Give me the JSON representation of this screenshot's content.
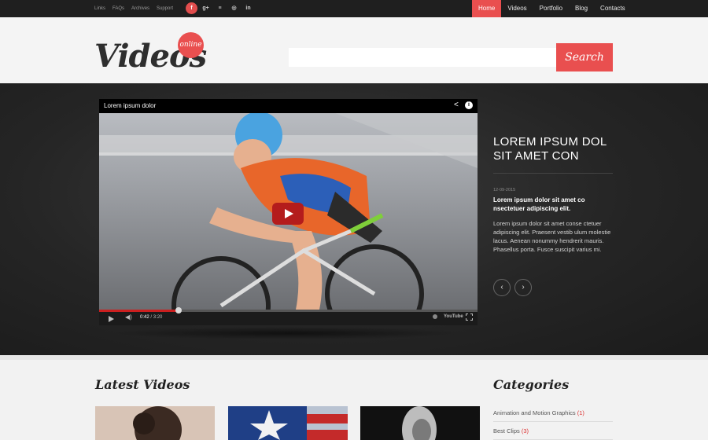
{
  "topbar": {
    "links": [
      "Links",
      "FAQs",
      "Archives",
      "Support"
    ],
    "social": [
      {
        "icon": "facebook-icon",
        "glyph": "f"
      },
      {
        "icon": "google-plus-icon",
        "glyph": "g+"
      },
      {
        "icon": "rss-icon",
        "glyph": "≡"
      },
      {
        "icon": "skype-icon",
        "glyph": "◎"
      },
      {
        "icon": "linkedin-icon",
        "glyph": "in"
      }
    ],
    "nav": [
      "Home",
      "Videos",
      "Portfolio",
      "Blog",
      "Contacts"
    ],
    "active_nav": "Home"
  },
  "header": {
    "logo_text": "Videos",
    "logo_badge": "online",
    "search_value": "",
    "search_button": "Search"
  },
  "player": {
    "title": "Lorem ipsum dolor",
    "current_time": "0:42",
    "duration": "3:20",
    "progress": 0.21,
    "brand": "YouTube"
  },
  "hero": {
    "heading": "LOREM IPSUM DOL SIT AMET CON",
    "date": "12-09-2015",
    "subtitle": "Lorem ipsum dolor sit amet co nsectetuer adipiscing elit.",
    "text": "Lorem ipsum dolor sit amet conse ctetuer adipiscing elit. Praesent vestib ulum molestie lacus. Aenean nonummy hendrerit mauris. Phasellus porta. Fusce suscipit varius mi."
  },
  "sections": {
    "latest": "Latest Videos",
    "categories": "Categories"
  },
  "categories": [
    {
      "name": "Animation and Motion Graphics",
      "count": "(1)"
    },
    {
      "name": "Best Clips",
      "count": "(3)"
    }
  ],
  "colors": {
    "accent": "#e94f4f",
    "dark": "#1f1f1f",
    "hero_bg": "#252525"
  }
}
